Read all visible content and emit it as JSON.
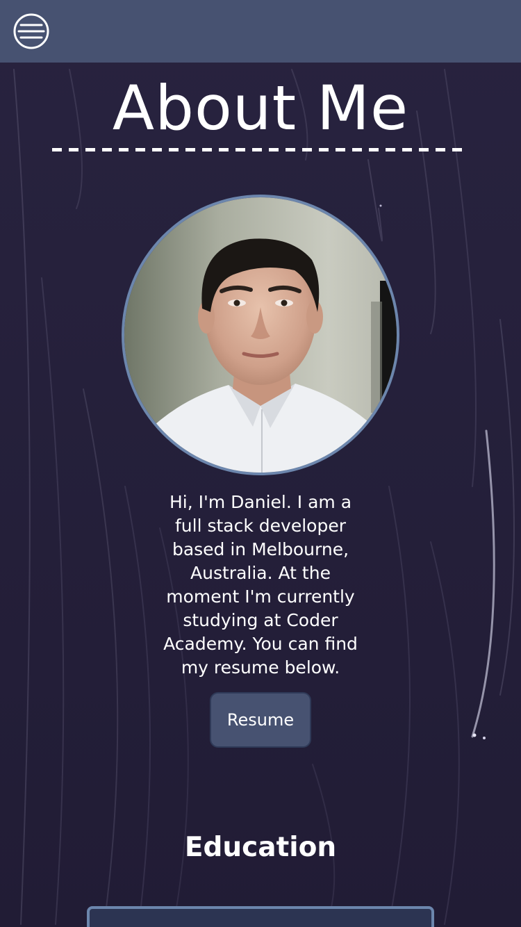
{
  "header": {
    "menu_icon": "hamburger-menu-icon",
    "background_color": "#475271"
  },
  "page": {
    "title": "About Me",
    "background_color": "#231f3a"
  },
  "profile": {
    "photo_alt": "Profile photo of Daniel",
    "border_color": "#6c86ad",
    "bio": "Hi, I'm Daniel. I am a full stack developer based in Melbourne, Australia. At the moment I'm currently studying at Coder Academy. You can find my resume below.",
    "resume_button_label": "Resume"
  },
  "education": {
    "heading": "Education"
  }
}
